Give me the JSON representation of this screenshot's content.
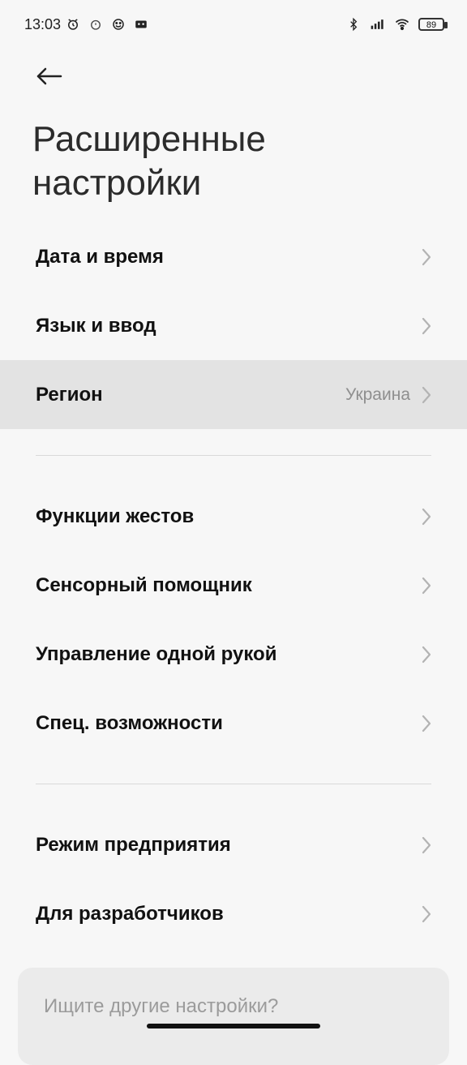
{
  "status_bar": {
    "time": "13:03",
    "battery": "89",
    "left_icons": [
      "alarm-icon",
      "alarm-outline-icon",
      "emoji-icon",
      "game-icon"
    ],
    "right_icons": [
      "bluetooth-icon",
      "signal-icon",
      "wifi-icon",
      "battery-icon"
    ]
  },
  "header": {
    "title_line1": "Расширенные",
    "title_line2": "настройки",
    "back_icon": "arrow-left-icon"
  },
  "sections": {
    "group1": [
      {
        "label": "Дата и время"
      },
      {
        "label": "Язык и ввод"
      },
      {
        "label": "Регион",
        "value": "Украина"
      }
    ],
    "group2": [
      {
        "label": "Функции жестов"
      },
      {
        "label": "Сенсорный помощник"
      },
      {
        "label": "Управление одной рукой"
      },
      {
        "label": "Спец. возможности"
      }
    ],
    "group3": [
      {
        "label": "Режим предприятия"
      },
      {
        "label": "Для разработчиков"
      }
    ]
  },
  "search_prompt": {
    "text": "Ищите другие настройки?"
  }
}
